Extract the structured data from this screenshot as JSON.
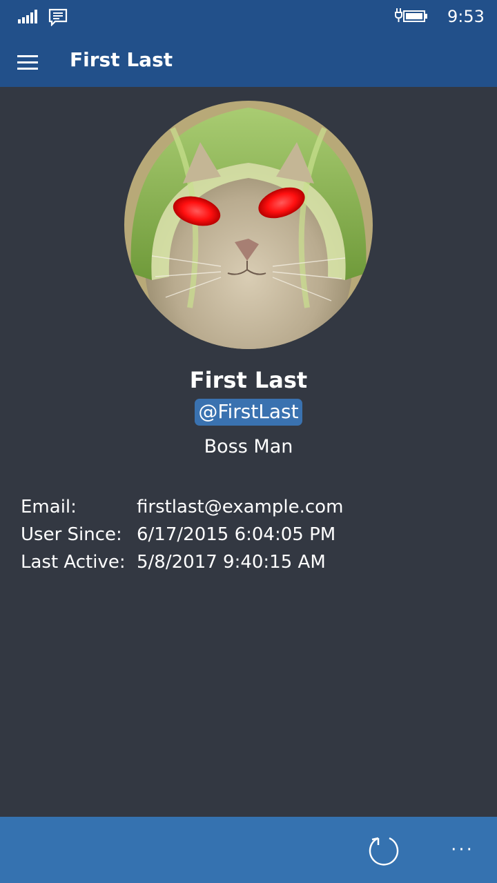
{
  "status_bar": {
    "time": "9:53",
    "icons": [
      "signal-icon",
      "message-icon",
      "battery-charging-icon"
    ]
  },
  "header": {
    "title": "First Last",
    "menu_icon": "hamburger-icon"
  },
  "profile": {
    "name": "First Last",
    "handle": "@FirstLast",
    "role": "Boss Man"
  },
  "details": {
    "email_label": "Email:",
    "email_value": "firstlast@example.com",
    "since_label": "User Since:",
    "since_value": "6/17/2015 6:04:05 PM",
    "active_label": "Last Active:",
    "active_value": "5/8/2017 9:40:15 AM"
  },
  "command_bar": {
    "more_label": "···",
    "icons": [
      "refresh-icon"
    ]
  },
  "colors": {
    "header": "#22508a",
    "background": "#333842",
    "command_bar": "#3572b0",
    "handle_highlight": "#3a72b0"
  }
}
